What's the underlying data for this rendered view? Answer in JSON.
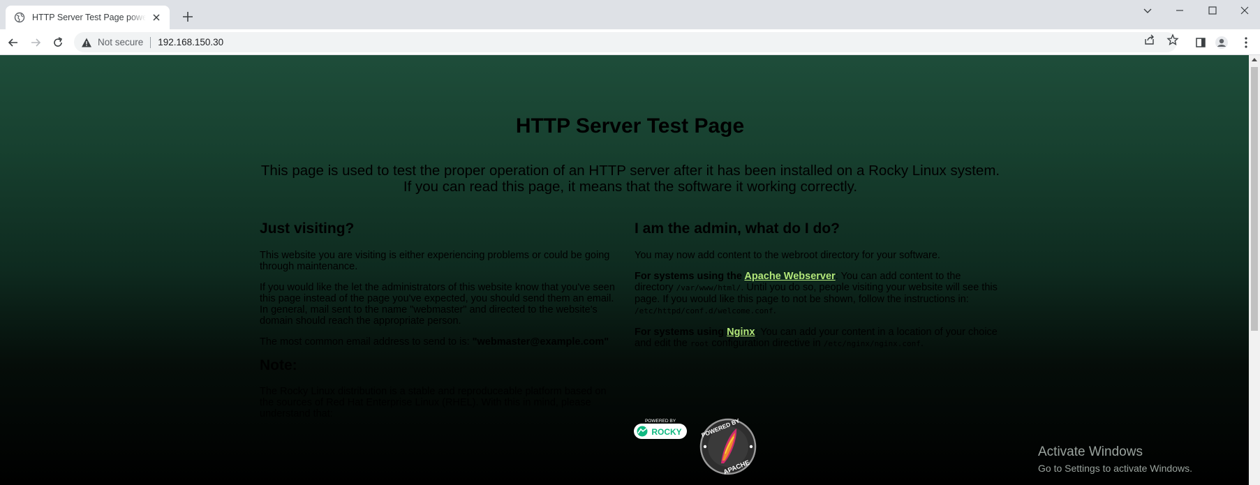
{
  "browser": {
    "tab_title": "HTTP Server Test Page powered by Rocky Linux",
    "security_label": "Not secure",
    "url": "192.168.150.30"
  },
  "page": {
    "title_part1": "HTTP Server ",
    "title_part2": "Test Page",
    "intro": "This page is used to test the proper operation of an HTTP server after it has been installed on a Rocky Linux system. If you can read this page, it means that the software it working correctly.",
    "left": {
      "heading": "Just visiting?",
      "p1": "This website you are visiting is either experiencing problems or could be going through maintenance.",
      "p2": "If you would like the let the administrators of this website know that you've seen this page instead of the page you've expected, you should send them an email. In general, mail sent to the name \"webmaster\" and directed to the website's domain should reach the appropriate person.",
      "p3_prefix": "The most common email address to send to is: ",
      "p3_email": "\"webmaster@example.com\"",
      "note_heading": "Note:",
      "p4": "The Rocky Linux distribution is a stable and reproduceable platform based on the sources of Red Hat Enterprise Linux (RHEL). With this in mind, please understand that:"
    },
    "right": {
      "heading": "I am the admin, what do I do?",
      "p1": "You may now add content to the webroot directory for your software.",
      "apache_prefix": "For systems using the ",
      "apache_link": "Apache Webserver",
      "apache_t1": ": You can add content to the directory ",
      "apache_code1": "/var/www/html/",
      "apache_t2": ". Until you do so, people visiting your website will see this page. If you would like this page to not be shown, follow the instructions in: ",
      "apache_code2": "/etc/httpd/conf.d/welcome.conf",
      "apache_t3": ".",
      "nginx_prefix": "For systems using ",
      "nginx_link": "Nginx",
      "nginx_t1": ": You can add your content in a location of your choice and edit the ",
      "nginx_code1": "root",
      "nginx_t2": " configuration directive in ",
      "nginx_code2": "/etc/nginx/nginx.conf",
      "nginx_t3": "."
    },
    "logos": {
      "rocky_small": "POWERED BY",
      "rocky_name": "ROCKY",
      "apache_top": "POWERED BY",
      "apache_bottom": "APACHE"
    }
  },
  "watermark": {
    "line1": "Activate Windows",
    "line2": "Go to Settings to activate Windows."
  },
  "colors": {
    "link": "#b3e87a",
    "bg_top": "#1e4d3a",
    "bg_bottom": "#000000"
  }
}
